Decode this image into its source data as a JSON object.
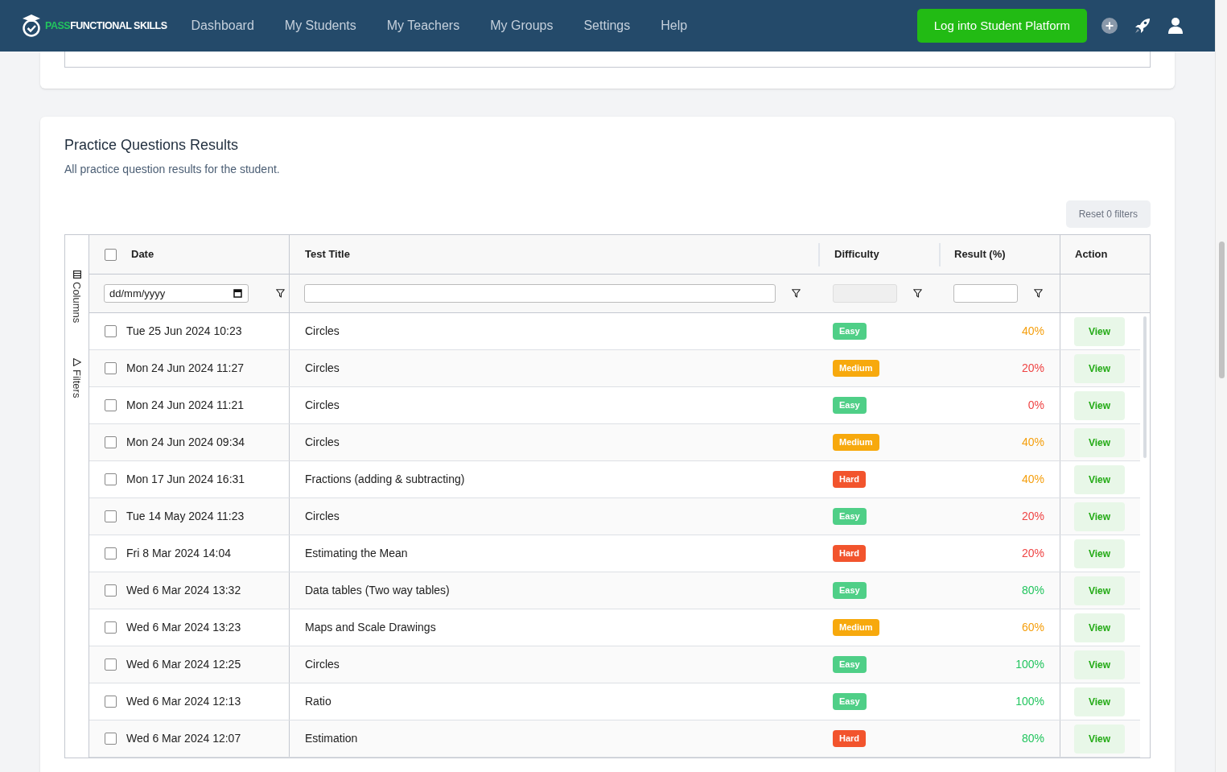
{
  "nav": {
    "logo_accent": "PASS",
    "logo_rest": "FUNCTIONAL SKILLS",
    "items": [
      "Dashboard",
      "My Students",
      "My Teachers",
      "My Groups",
      "Settings",
      "Help"
    ],
    "cta": "Log into Student Platform"
  },
  "card": {
    "title": "Practice Questions Results",
    "subtitle": "All practice question results for the student.",
    "reset": "Reset 0 filters"
  },
  "side_panel": [
    "Columns",
    "Filters"
  ],
  "columns": [
    "Date",
    "Test Title",
    "Difficulty",
    "Result (%)",
    "Action"
  ],
  "date_placeholder": "dd/mm/yyyy",
  "header_checkbox": {
    "checked": false
  },
  "rows": [
    {
      "date": "Tue 25 Jun 2024 10:23",
      "title": "Circles",
      "difficulty": {
        "label": "Easy",
        "kind": "easy"
      },
      "result": {
        "text": "40%",
        "color": "#f59e0b"
      },
      "action": "View",
      "selected": false
    },
    {
      "date": "Mon 24 Jun 2024 11:27",
      "title": "Circles",
      "difficulty": {
        "label": "Medium",
        "kind": "medium"
      },
      "result": {
        "text": "20%",
        "color": "#ef4444"
      },
      "action": "View",
      "selected": false
    },
    {
      "date": "Mon 24 Jun 2024 11:21",
      "title": "Circles",
      "difficulty": {
        "label": "Easy",
        "kind": "easy"
      },
      "result": {
        "text": "0%",
        "color": "#ef4444"
      },
      "action": "View",
      "selected": false
    },
    {
      "date": "Mon 24 Jun 2024 09:34",
      "title": "Circles",
      "difficulty": {
        "label": "Medium",
        "kind": "medium"
      },
      "result": {
        "text": "40%",
        "color": "#f59e0b"
      },
      "action": "View",
      "selected": false
    },
    {
      "date": "Mon 17 Jun 2024 16:31",
      "title": "Fractions (adding & subtracting)",
      "difficulty": {
        "label": "Hard",
        "kind": "hard"
      },
      "result": {
        "text": "40%",
        "color": "#f59e0b"
      },
      "action": "View",
      "selected": false
    },
    {
      "date": "Tue 14 May 2024 11:23",
      "title": "Circles",
      "difficulty": {
        "label": "Easy",
        "kind": "easy"
      },
      "result": {
        "text": "20%",
        "color": "#ef4444"
      },
      "action": "View",
      "selected": false
    },
    {
      "date": "Fri 8 Mar 2024 14:04",
      "title": "Estimating the Mean",
      "difficulty": {
        "label": "Hard",
        "kind": "hard"
      },
      "result": {
        "text": "20%",
        "color": "#ef4444"
      },
      "action": "View",
      "selected": false
    },
    {
      "date": "Wed 6 Mar 2024 13:32",
      "title": "Data tables (Two way tables)",
      "difficulty": {
        "label": "Easy",
        "kind": "easy"
      },
      "result": {
        "text": "80%",
        "color": "#22c55e"
      },
      "action": "View",
      "selected": false
    },
    {
      "date": "Wed 6 Mar 2024 13:23",
      "title": "Maps and Scale Drawings",
      "difficulty": {
        "label": "Medium",
        "kind": "medium"
      },
      "result": {
        "text": "60%",
        "color": "#f59e0b"
      },
      "action": "View",
      "selected": false
    },
    {
      "date": "Wed 6 Mar 2024 12:25",
      "title": "Circles",
      "difficulty": {
        "label": "Easy",
        "kind": "easy"
      },
      "result": {
        "text": "100%",
        "color": "#22c55e"
      },
      "action": "View",
      "selected": false
    },
    {
      "date": "Wed 6 Mar 2024 12:13",
      "title": "Ratio",
      "difficulty": {
        "label": "Easy",
        "kind": "easy"
      },
      "result": {
        "text": "100%",
        "color": "#22c55e"
      },
      "action": "View",
      "selected": false
    },
    {
      "date": "Wed 6 Mar 2024 12:07",
      "title": "Estimation",
      "difficulty": {
        "label": "Hard",
        "kind": "hard"
      },
      "result": {
        "text": "80%",
        "color": "#22c55e"
      },
      "action": "View",
      "selected": false
    }
  ]
}
